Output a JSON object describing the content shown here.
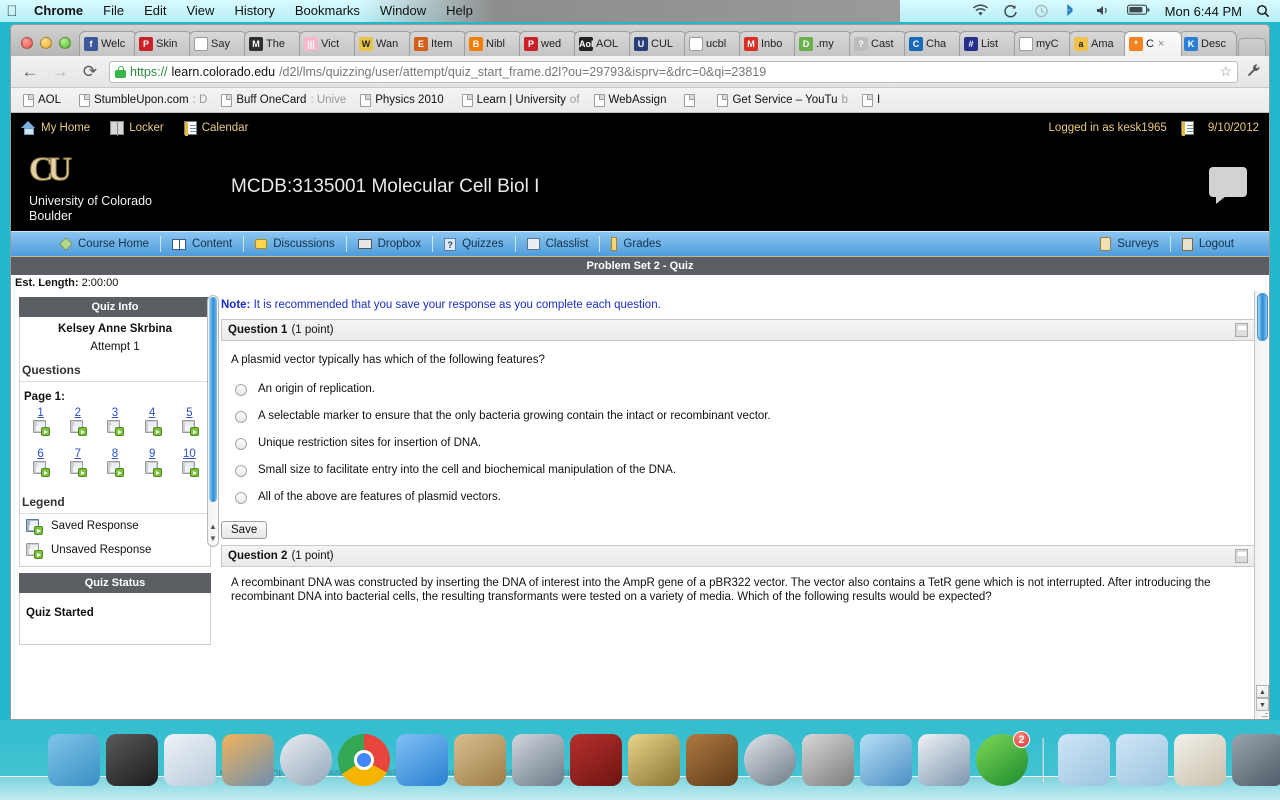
{
  "menubar": {
    "apple": "apple-logo",
    "items": [
      "Chrome",
      "File",
      "Edit",
      "View",
      "History",
      "Bookmarks",
      "Window",
      "Help"
    ],
    "status_icons": [
      "wifi-icon",
      "sync-icon",
      "time-machine-icon",
      "bluetooth-icon",
      "volume-icon",
      "battery-icon"
    ],
    "clock": "Mon 6:44 PM",
    "spotlight": "search-icon"
  },
  "browser": {
    "tabs": [
      {
        "label": "Welc",
        "favicon": "f",
        "color": "#3b5998",
        "active": false
      },
      {
        "label": "Skin",
        "favicon": "P",
        "color": "#cb2027",
        "active": false
      },
      {
        "label": "Say",
        "favicon": "page",
        "color": "#ffffff",
        "active": false
      },
      {
        "label": "The",
        "favicon": "M",
        "color": "#2f2f2f",
        "active": false
      },
      {
        "label": "Vict",
        "favicon": "|||",
        "color": "#f7b7cb",
        "active": false
      },
      {
        "label": "Wan",
        "favicon": "W",
        "color": "#e8c547",
        "active": false
      },
      {
        "label": "Item",
        "favicon": "E",
        "color": "#d2601a",
        "active": false
      },
      {
        "label": "Nibl",
        "favicon": "B",
        "color": "#f57d00",
        "active": false
      },
      {
        "label": "wed",
        "favicon": "P",
        "color": "#cb2027",
        "active": false
      },
      {
        "label": "AOL",
        "favicon": "Aol",
        "color": "#222222",
        "active": false
      },
      {
        "label": "CUL",
        "favicon": "U",
        "color": "#2a3f7a",
        "active": false
      },
      {
        "label": "ucbl",
        "favicon": "page",
        "color": "#ffffff",
        "active": false
      },
      {
        "label": "Inbo",
        "favicon": "M",
        "color": "#d93025",
        "active": false
      },
      {
        "label": ".my",
        "favicon": "D",
        "color": "#6ab04c",
        "active": false
      },
      {
        "label": "Cast",
        "favicon": "?",
        "color": "#bdbdbd",
        "active": false
      },
      {
        "label": "Cha",
        "favicon": "C",
        "color": "#1b69b6",
        "active": false
      },
      {
        "label": "List",
        "favicon": "#",
        "color": "#26308c",
        "active": false
      },
      {
        "label": "myC",
        "favicon": "page",
        "color": "#ffffff",
        "active": false
      },
      {
        "label": "Ama",
        "favicon": "a",
        "color": "#f0c14b",
        "active": false
      },
      {
        "label": "C",
        "favicon": "*",
        "color": "#f58220",
        "active": true,
        "close": "×"
      },
      {
        "label": "Desc",
        "favicon": "K",
        "color": "#2b7fd4",
        "active": false
      }
    ],
    "new_tab_label": "",
    "nav": {
      "back": "←",
      "forward": "→",
      "reload": "⟳"
    },
    "url_scheme": "https://",
    "url_host": "learn.colorado.edu",
    "url_path": "/d2l/lms/quizzing/user/attempt/quiz_start_frame.d2l?ou=29793&isprv=&drc=0&qi=23819",
    "lock": "lock-icon",
    "star": "☆",
    "wrench": "🔧",
    "bookmarks": [
      {
        "title": "AOL",
        "sub": ""
      },
      {
        "title": "StumbleUpon.com",
        "sub": ": D"
      },
      {
        "title": "Buff OneCard",
        "sub": ": Unive"
      },
      {
        "title": "Physics 2010",
        "sub": ""
      },
      {
        "title": "Learn | University",
        "sub": " of"
      },
      {
        "title": "WebAssign",
        "sub": ""
      },
      {
        "title": "",
        "sub": ""
      },
      {
        "title": "Get Service – YouTu",
        "sub": "b"
      },
      {
        "title": "I",
        "sub": ""
      }
    ]
  },
  "d2l": {
    "topnav": [
      {
        "label": "My Home",
        "icon": "home-icon"
      },
      {
        "label": "Locker",
        "icon": "locker-icon"
      },
      {
        "label": "Calendar",
        "icon": "calendar-icon"
      }
    ],
    "logged_in_as": "Logged in as kesk1965",
    "date": "9/10/2012",
    "date_icon": "calendar-icon",
    "logo_mark": "CU",
    "logo_name_line1": "University of Colorado",
    "logo_name_line2": "Boulder",
    "course_title": "MCDB:3135001 Molecular Cell Biol I",
    "chat_icon": "chat-bubble-icon",
    "navbar": [
      {
        "label": "Course Home",
        "icon": "diamond-icon"
      },
      {
        "label": "Content",
        "icon": "book-icon"
      },
      {
        "label": "Discussions",
        "icon": "chat-icon"
      },
      {
        "label": "Dropbox",
        "icon": "tray-icon"
      },
      {
        "label": "Quizzes",
        "icon": "question-icon"
      },
      {
        "label": "Classlist",
        "icon": "grid-icon"
      },
      {
        "label": "Grades",
        "icon": "ruler-icon"
      }
    ],
    "navbar_right": [
      {
        "label": "Surveys",
        "icon": "clipboard-icon"
      },
      {
        "label": "Logout",
        "icon": "door-icon"
      }
    ]
  },
  "quiz": {
    "banner_title": "Problem Set 2 - Quiz",
    "est_length_label": "Est. Length:",
    "est_length_value": "2:00:00",
    "info_panel": {
      "heading": "Quiz Info",
      "student_name": "Kelsey Anne Skrbina",
      "attempt": "Attempt 1",
      "questions_heading": "Questions",
      "page_label": "Page 1:",
      "question_numbers": [
        "1",
        "2",
        "3",
        "4",
        "5",
        "6",
        "7",
        "8",
        "9",
        "10"
      ],
      "legend_heading": "Legend",
      "legend": [
        {
          "label": "Saved Response",
          "icon": "saved-response-icon"
        },
        {
          "label": "Unsaved Response",
          "icon": "unsaved-response-icon"
        }
      ]
    },
    "status_panel": {
      "heading": "Quiz Status",
      "status": "Quiz Started"
    },
    "note_prefix": "Note:",
    "note_text": " It is recommended that you save your response as you complete each question.",
    "questions": [
      {
        "title": "Question 1",
        "points": "(1 point)",
        "text": "A plasmid vector typically has which of the following features?",
        "options": [
          "An origin of replication.",
          "A selectable marker to ensure that the only bacteria growing contain the intact or recombinant vector.",
          "Unique restriction sites for insertion of DNA.",
          "Small size to facilitate entry into the cell and biochemical manipulation of the DNA.",
          "All of the above are features of plasmid vectors."
        ],
        "save_label": "Save"
      },
      {
        "title": "Question 2",
        "points": "(1 point)",
        "text": "A recombinant DNA was constructed by inserting the DNA of interest into the AmpR gene of a pBR322 vector.  The vector also contains a TetR gene which is not interrupted.  After introducing the recombinant DNA into bacterial cells, the resulting transformants were tested on a variety of media.  Which of the following results would be expected?",
        "options": [],
        "save_label": ""
      }
    ]
  },
  "dock": {
    "items": [
      {
        "name": "finder",
        "color1": "#7fc5e8",
        "color2": "#3a8fc4"
      },
      {
        "name": "dashboard",
        "color1": "#5a5a5a",
        "color2": "#1c1c1c"
      },
      {
        "name": "mail",
        "color1": "#eef3f8",
        "color2": "#b9cada"
      },
      {
        "name": "iphoto",
        "color1": "#f2b35a",
        "color2": "#6d8fb0"
      },
      {
        "name": "safari",
        "color1": "#e9edf1",
        "color2": "#93a7bb"
      },
      {
        "name": "chrome",
        "color1": "#e8453c",
        "color2": "#f4b400"
      },
      {
        "name": "facetime",
        "color1": "#7fc0f5",
        "color2": "#2a7fd0"
      },
      {
        "name": "address-book",
        "color1": "#d9bf8e",
        "color2": "#9c7c46"
      },
      {
        "name": "photo-booth-camera",
        "color1": "#cfd6dd",
        "color2": "#6d7a87"
      },
      {
        "name": "photo-booth",
        "color1": "#b8302c",
        "color2": "#6d1512"
      },
      {
        "name": "imovie",
        "color1": "#e8d48a",
        "color2": "#8a7430"
      },
      {
        "name": "garageband",
        "color1": "#b07a42",
        "color2": "#5e3a18"
      },
      {
        "name": "time-machine",
        "color1": "#dfe5ea",
        "color2": "#6e7a85"
      },
      {
        "name": "system-preferences",
        "color1": "#d8d8d8",
        "color2": "#7d7d7d"
      },
      {
        "name": "wave",
        "color1": "#b8dff6",
        "color2": "#4b8fc4"
      },
      {
        "name": "hp-printer",
        "color1": "#eef2f6",
        "color2": "#7d96ae"
      },
      {
        "name": "spotify",
        "color1": "#7ed957",
        "color2": "#1c8a2e",
        "badge": "2"
      },
      {
        "name": "applications-folder",
        "color1": "#cfe6f6",
        "color2": "#9cc4e0"
      },
      {
        "name": "documents-folder",
        "color1": "#cfe6f6",
        "color2": "#9cc4e0"
      },
      {
        "name": "document-stack",
        "color1": "#f2f0ea",
        "color2": "#c8c0ab"
      },
      {
        "name": "server-rack",
        "color1": "#9aa4ae",
        "color2": "#4e5a66"
      },
      {
        "name": "trash",
        "color1": "#e4e8ec",
        "color2": "#9aa3ab"
      }
    ],
    "reflection_text": "recombinant DNA into bacterial cells, the resulting transformants were tested on a variety of media."
  }
}
